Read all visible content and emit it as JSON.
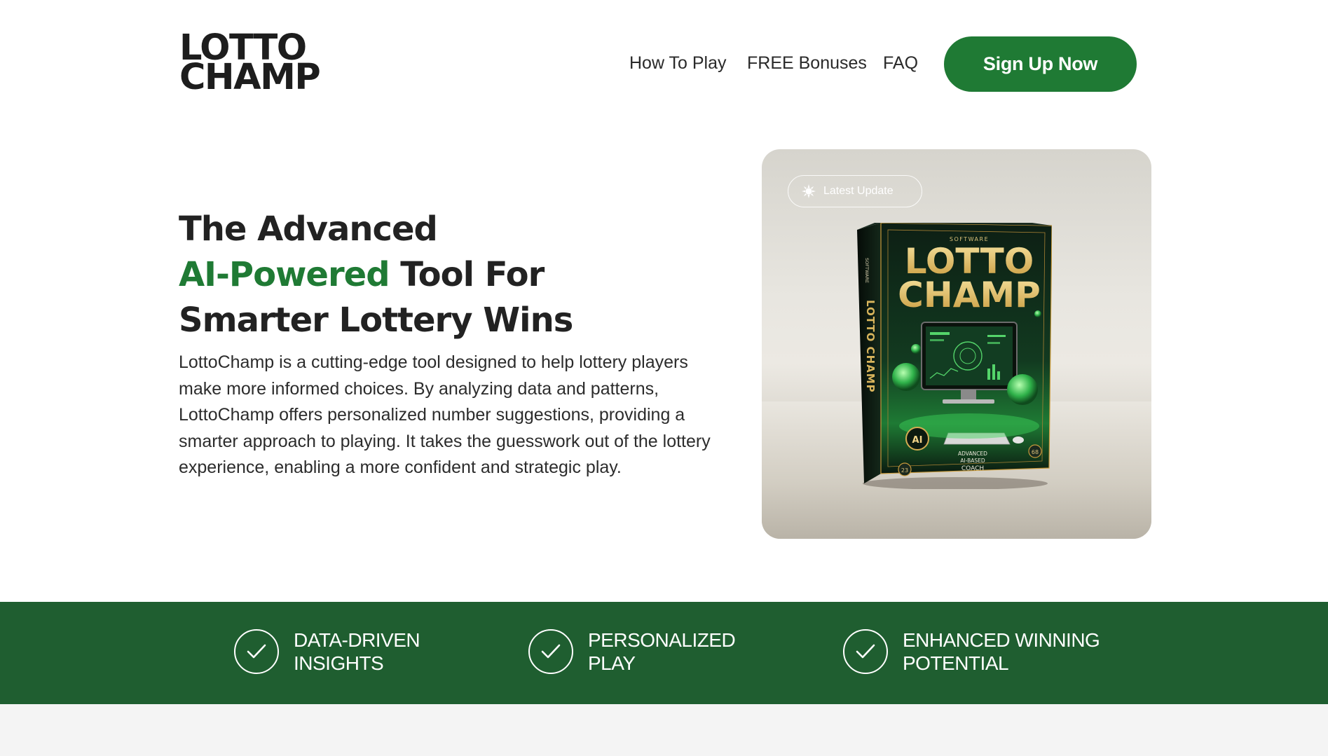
{
  "brand": {
    "line1": "LOTTO",
    "line2": "CHAMP"
  },
  "nav": {
    "items": [
      {
        "label": "How To Play"
      },
      {
        "label": "FREE Bonuses"
      },
      {
        "label": "FAQ"
      }
    ],
    "cta_label": "Sign Up Now"
  },
  "hero": {
    "title_line1": "The Advanced",
    "title_accent": "AI-Powered",
    "title_line2_rest": " Tool For",
    "title_line3": "Smarter Lottery Wins",
    "description": "LottoChamp is a cutting-edge tool designed to help lottery players make more informed choices. By analyzing data and patterns, LottoChamp offers personalized number suggestions, providing a smarter approach to playing. It takes the guesswork out of the lottery experience, enabling a more confident and strategic play."
  },
  "product": {
    "badge_label": "Latest Update",
    "box": {
      "top_label": "SOFTWARE",
      "title_line1": "LOTTO",
      "title_line2": "CHAMP",
      "ai_label": "AI",
      "subtitle_line1": "ADVANCED",
      "subtitle_line2": "AI-BASED",
      "subtitle_line3": "COACH",
      "spine_label": "LOTTO CHAMP",
      "spine_top": "SOFTWARE",
      "ball_left": "23",
      "ball_right": "68"
    }
  },
  "features": [
    {
      "line1": "DATA-DRIVEN",
      "line2": "INSIGHTS"
    },
    {
      "line1": "PERSONALIZED",
      "line2": "PLAY"
    },
    {
      "line1": "ENHANCED WINNING",
      "line2": "POTENTIAL"
    }
  ],
  "colors": {
    "accent_green": "#1f7a34",
    "band_green": "#1f5e30",
    "text_dark": "#222222"
  }
}
